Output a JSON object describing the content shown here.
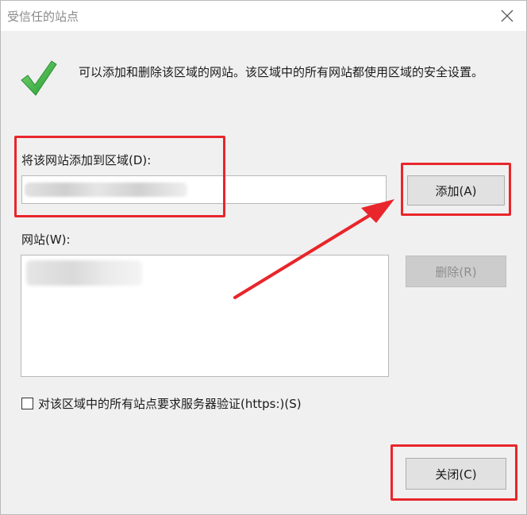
{
  "dialog": {
    "title": "受信任的站点",
    "description": "可以添加和删除该区域的网站。该区域中的所有网站都使用区域的安全设置。",
    "add_label": "将该网站添加到区域(D):",
    "add_input_value": "",
    "add_button": "添加(A)",
    "sites_label": "网站(W):",
    "remove_button": "删除(R)",
    "https_checkbox_label": "对该区域中的所有站点要求服务器验证(https:)(S)",
    "https_checked": false,
    "close_button": "关闭(C)"
  },
  "icons": {
    "check": "green-checkmark-icon",
    "close": "close-icon"
  },
  "colors": {
    "annotation_red": "#e8262b",
    "check_green": "#3cb043"
  }
}
